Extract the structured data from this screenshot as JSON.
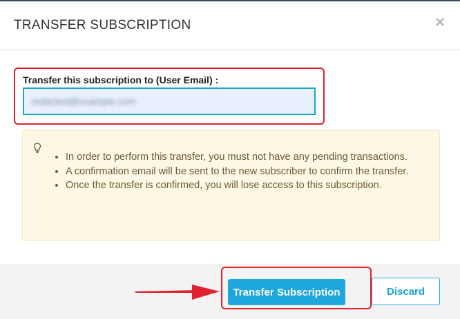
{
  "dialog": {
    "title": "TRANSFER SUBSCRIPTION",
    "close_glyph": "×"
  },
  "form": {
    "email_label": "Transfer this subscription to (User Email) :",
    "email_value": "redacted@example.com"
  },
  "notice": {
    "icon": "lightbulb-icon",
    "items": [
      "In order to perform this transfer, you must not have any pending transactions.",
      "A confirmation email will be sent to the new subscriber to confirm the transfer.",
      "Once the transfer is confirmed, you will lose access to this subscription."
    ]
  },
  "footer": {
    "transfer_label": "Transfer Subscription",
    "discard_label": "Discard"
  },
  "colors": {
    "primary": "#1da7dd",
    "highlight": "#e0212e",
    "alert_bg": "#fcf8e3",
    "alert_text": "#6e5a35"
  }
}
